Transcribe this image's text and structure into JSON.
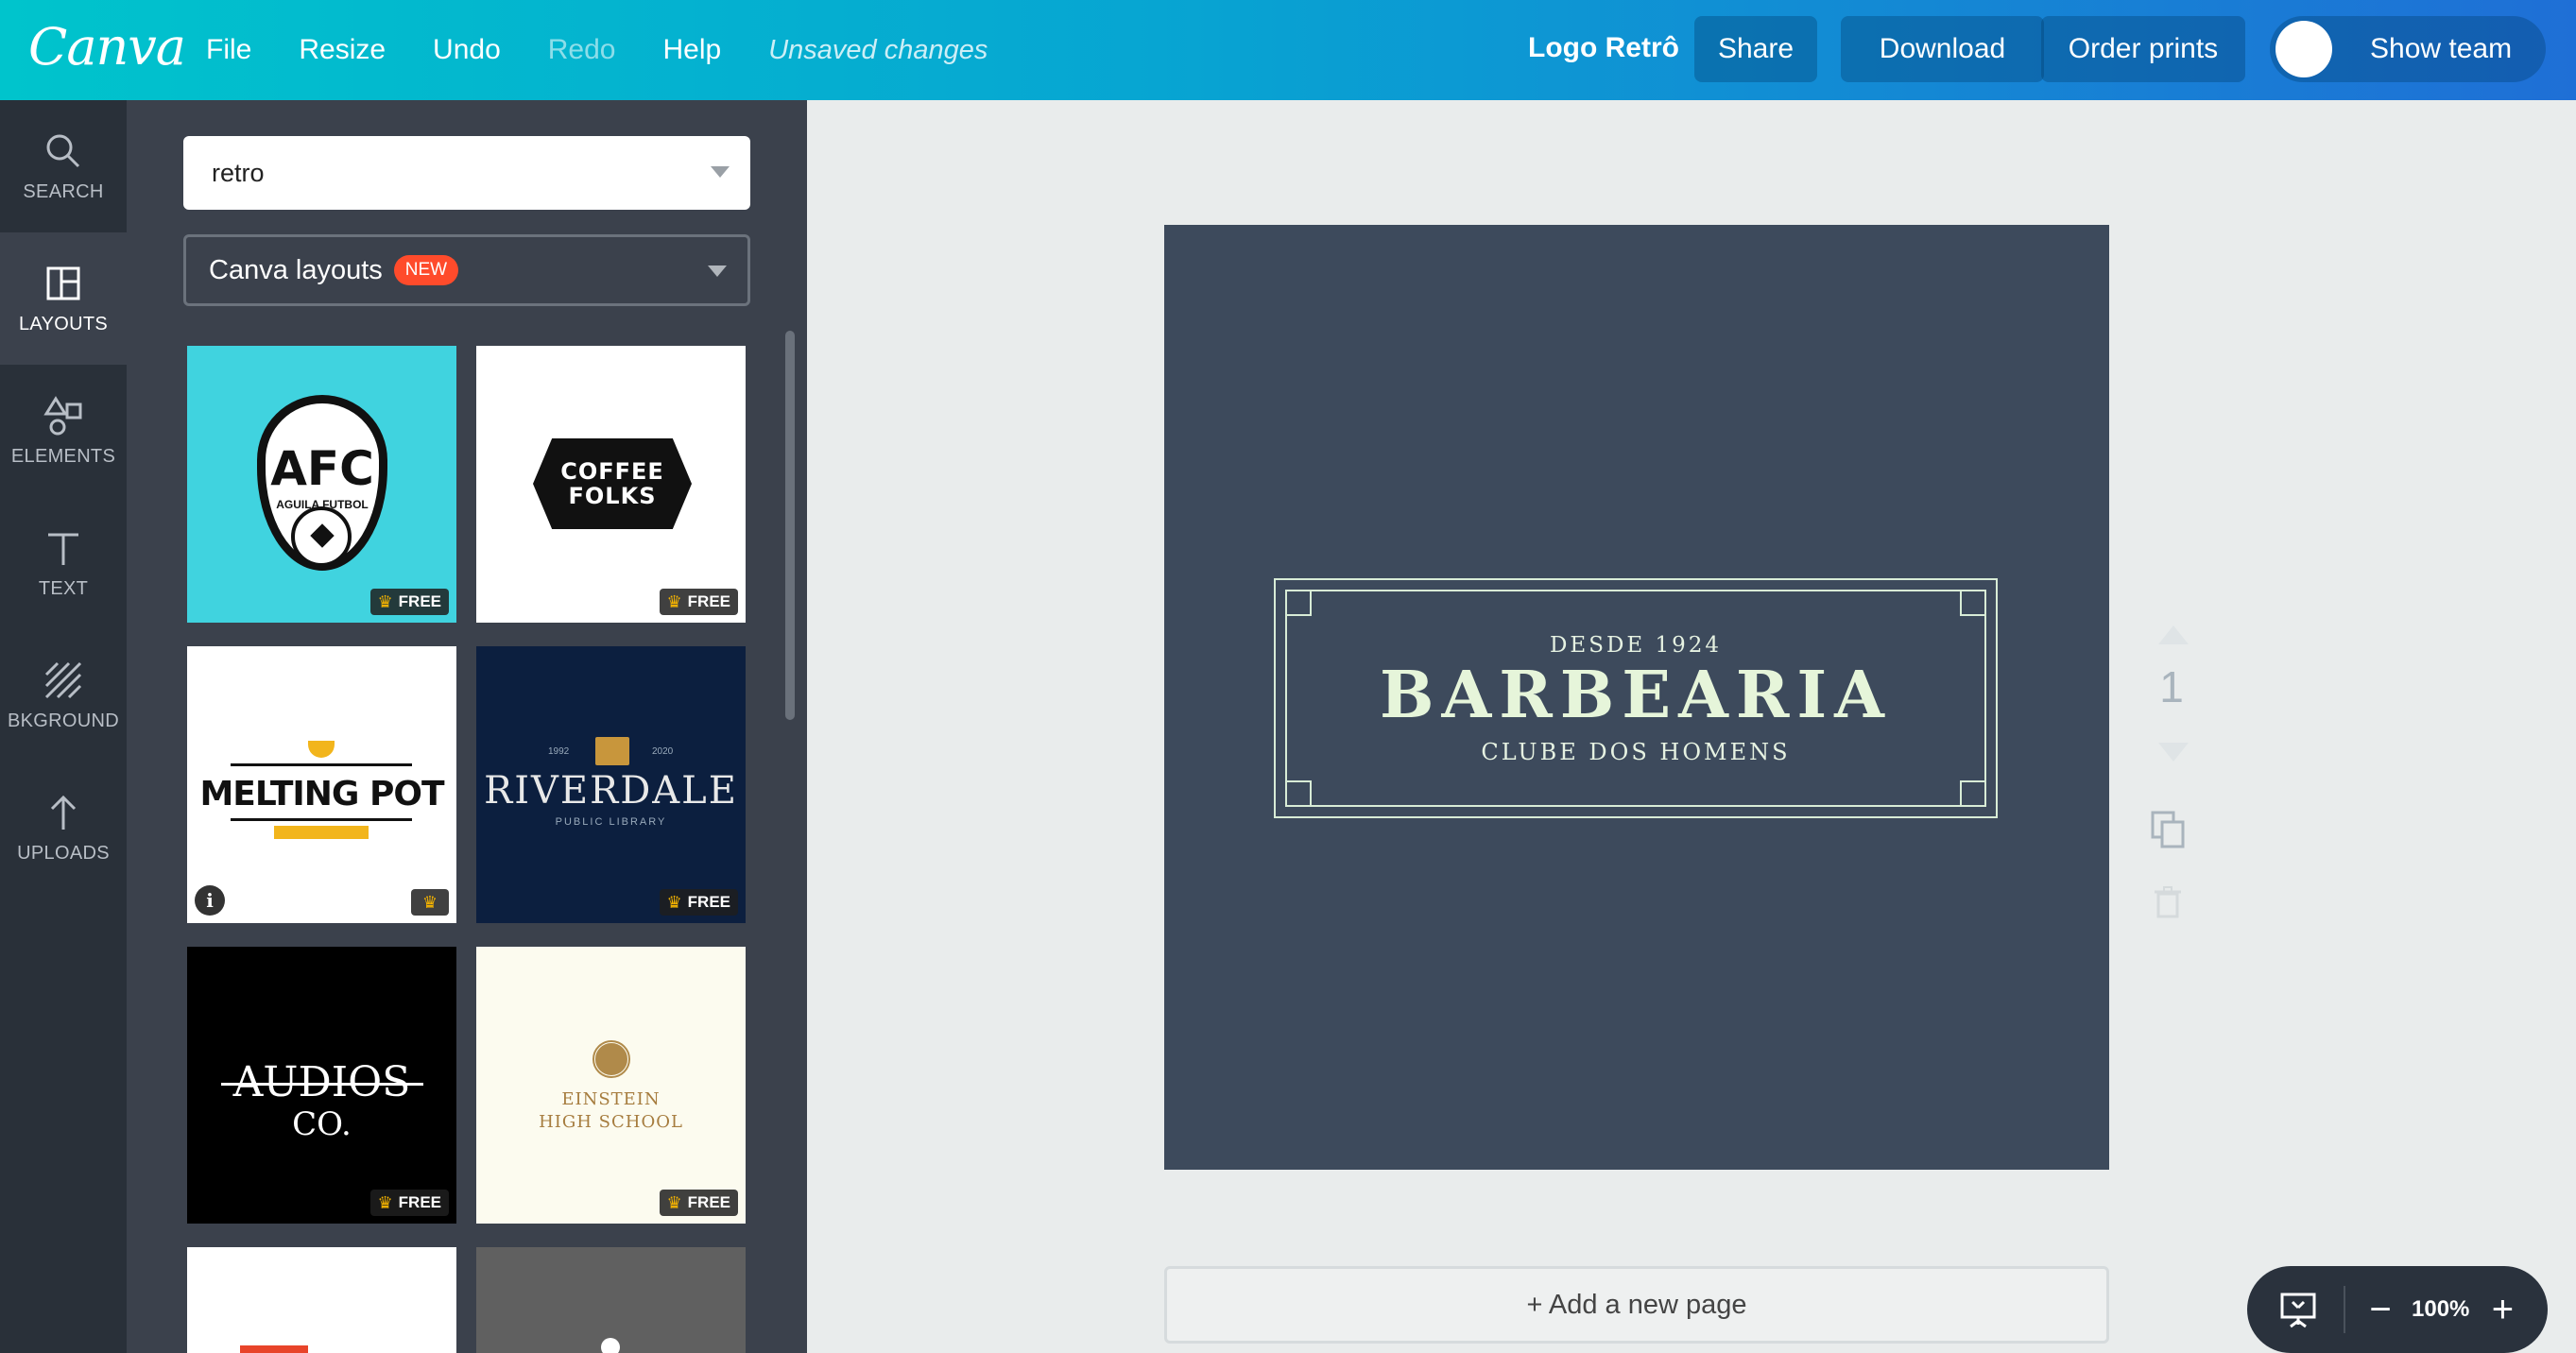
{
  "app": {
    "brand": "Canva"
  },
  "menu": {
    "file": "File",
    "resize": "Resize",
    "undo": "Undo",
    "redo": "Redo",
    "help": "Help",
    "status": "Unsaved changes"
  },
  "header": {
    "doc_title": "Logo Retrô",
    "share": "Share",
    "download": "Download",
    "order_prints": "Order prints",
    "show_team": "Show team"
  },
  "rail": [
    {
      "label": "SEARCH",
      "icon": "search-icon"
    },
    {
      "label": "LAYOUTS",
      "icon": "layouts-icon"
    },
    {
      "label": "ELEMENTS",
      "icon": "elements-icon"
    },
    {
      "label": "TEXT",
      "icon": "text-icon"
    },
    {
      "label": "BKGROUND",
      "icon": "background-icon"
    },
    {
      "label": "UPLOADS",
      "icon": "upload-icon"
    }
  ],
  "panel": {
    "search_value": "retro",
    "layouts_label": "Canva layouts",
    "new_badge": "NEW",
    "free": "FREE",
    "tiles": {
      "afc": {
        "title": "AFC",
        "sub": "AGUILA FUTBOL"
      },
      "coffee": {
        "line1": "COFFEE",
        "line2": "FOLKS"
      },
      "melting": {
        "title": "MELTING POT"
      },
      "riverdale": {
        "title": "RIVERDALE",
        "sub": "PUBLIC LIBRARY",
        "year_left": "1992",
        "year_right": "2020"
      },
      "audios": {
        "line1": "AUDIOS",
        "line2": "CO."
      },
      "einstein": {
        "line1": "EINSTEIN",
        "line2": "HIGH SCHOOL"
      }
    }
  },
  "design": {
    "top": "DESDE 1924",
    "main": "BARBEARIA",
    "bottom": "CLUBE DOS HOMENS",
    "bg_color": "#3d4a5c",
    "text_color": "#e6f5da"
  },
  "page_tools": {
    "page_number": "1"
  },
  "footer": {
    "add_page": "+ Add a new page",
    "zoom": "100%",
    "zoom_minus": "−",
    "zoom_plus": "+"
  }
}
